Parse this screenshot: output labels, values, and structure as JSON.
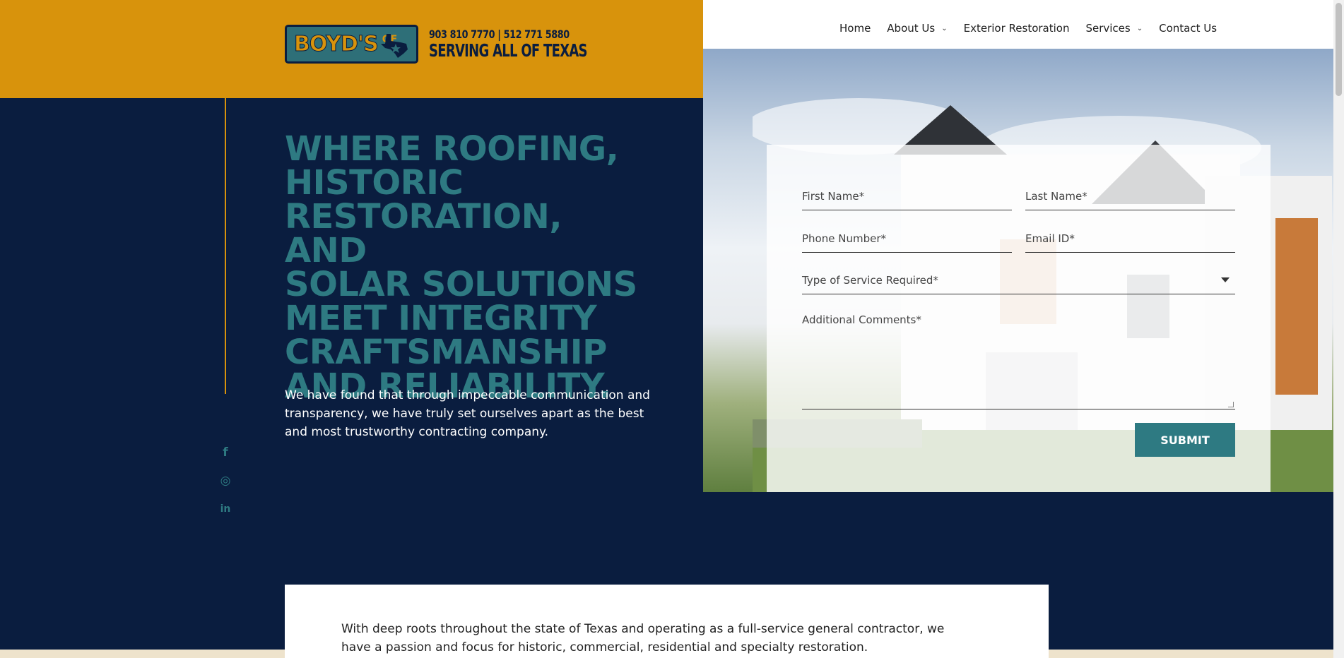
{
  "header": {
    "logo": {
      "brand": "BOYD'S",
      "brand_suffix": "OF",
      "phones": "903 810 7770 | 512 771 5880",
      "tagline": "SERVING ALL OF TEXAS"
    },
    "nav": [
      {
        "label": "Home",
        "has_dropdown": false
      },
      {
        "label": "About Us",
        "has_dropdown": true
      },
      {
        "label": "Exterior Restoration",
        "has_dropdown": false
      },
      {
        "label": "Services",
        "has_dropdown": true
      },
      {
        "label": "Contact Us",
        "has_dropdown": false
      }
    ]
  },
  "hero": {
    "headline_lines": [
      "WHERE ROOFING,",
      "HISTORIC",
      "RESTORATION, AND",
      "SOLAR SOLUTIONS",
      "MEET INTEGRITY",
      "CRAFTSMANSHIP",
      "AND RELIABILITY."
    ],
    "intro": "We have found that through impeccable communication and transparency, we have truly set ourselves apart as the best and most trustworthy contracting company."
  },
  "social": [
    {
      "name": "facebook",
      "glyph": "f"
    },
    {
      "name": "instagram",
      "glyph": "◎"
    },
    {
      "name": "linkedin",
      "glyph": "in"
    }
  ],
  "form": {
    "first_name_placeholder": "First Name*",
    "last_name_placeholder": "Last Name*",
    "phone_placeholder": "Phone Number*",
    "email_placeholder": "Email ID*",
    "service_placeholder": "Type of Service Required*",
    "comments_placeholder": "Additional Comments*",
    "submit_label": "SUBMIT"
  },
  "about": {
    "text": "With deep roots throughout the state of Texas and operating as a full-service general contractor, we have a passion and focus for historic, commercial, residential and specialty restoration."
  },
  "colors": {
    "accent_gold": "#d8930c",
    "navy": "#0a1d3f",
    "teal": "#2e7a82",
    "white": "#ffffff"
  }
}
